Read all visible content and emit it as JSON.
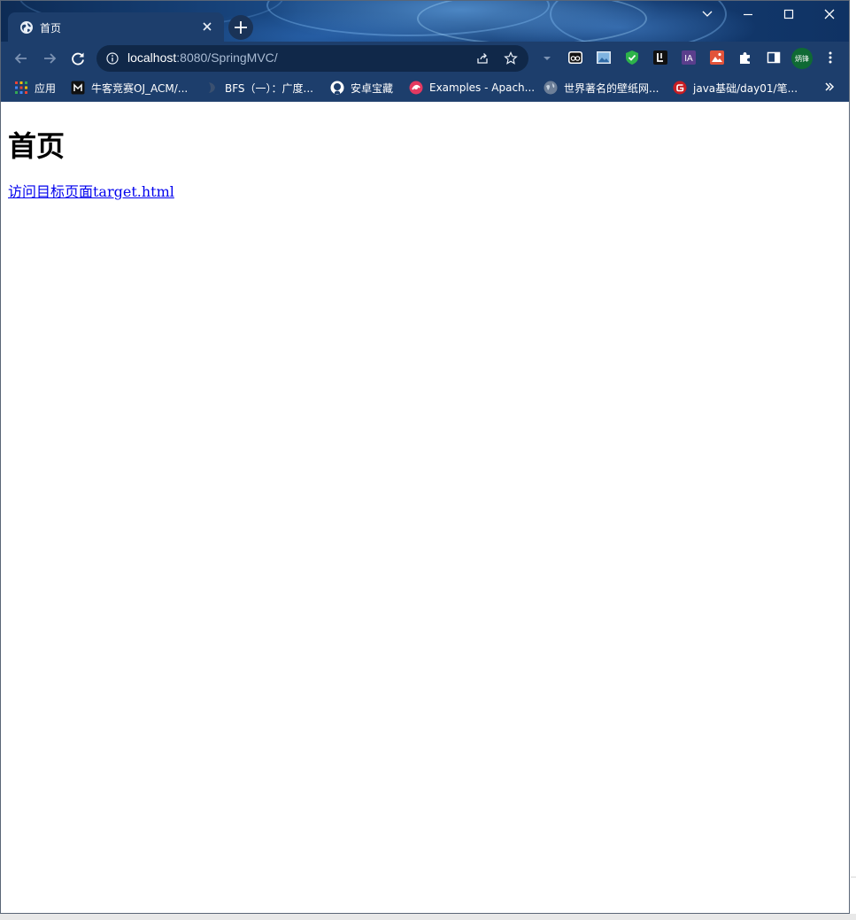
{
  "browser": {
    "tab": {
      "title": "首页"
    },
    "address_bar": {
      "host": "localhost",
      "rest": ":8080/SpringMVC/"
    },
    "profile_avatar": {
      "text": "炳锋"
    },
    "bookmarks": [
      {
        "label": "应用",
        "icon": "apps-grid-icon"
      },
      {
        "label": "牛客竞赛OJ_ACM/...",
        "icon": "nowcoder-icon"
      },
      {
        "label": "BFS（一）：广度...",
        "icon": "bfs-favicon"
      },
      {
        "label": "安卓宝藏",
        "icon": "github-icon"
      },
      {
        "label": "Examples - Apach...",
        "icon": "apache-echarts-icon"
      },
      {
        "label": "世界著名的壁纸网...",
        "icon": "globe-icon"
      },
      {
        "label": "java基础/day01/笔...",
        "icon": "gitee-icon"
      }
    ],
    "colors": {
      "frame": "#1d3e6c",
      "omnibox": "#102849",
      "link": "#0000ee"
    }
  },
  "page": {
    "heading": "首页",
    "link_text": "访问目标页面target.html"
  }
}
